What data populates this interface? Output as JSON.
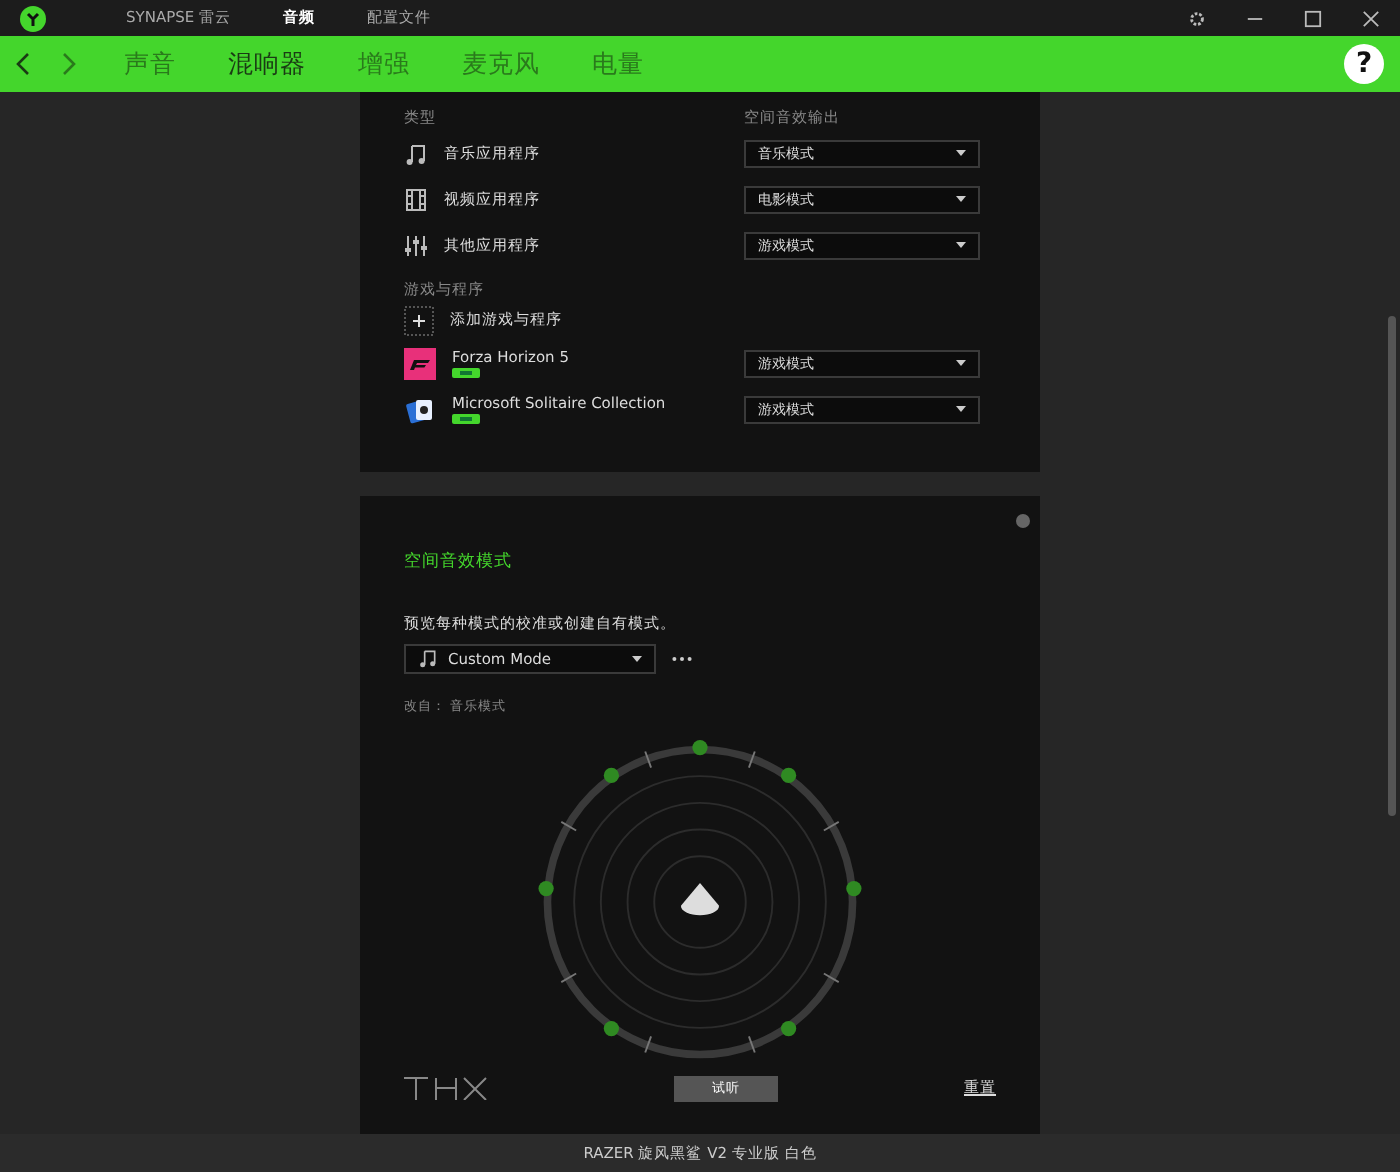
{
  "titlebar": {
    "tabs": [
      {
        "label": "SYNAPSE 雷云",
        "selected": false
      },
      {
        "label": "音频",
        "selected": true
      },
      {
        "label": "配置文件",
        "selected": false
      }
    ]
  },
  "nav": {
    "tabs": [
      {
        "label": "声音",
        "selected": false
      },
      {
        "label": "混响器",
        "selected": true
      },
      {
        "label": "增强",
        "selected": false
      },
      {
        "label": "麦克风",
        "selected": false
      },
      {
        "label": "电量",
        "selected": false
      }
    ],
    "help": "?"
  },
  "types": {
    "heading": "类型",
    "output_heading": "空间音效输出",
    "rows": [
      {
        "kind": "music",
        "label": "音乐应用程序",
        "mode": "音乐模式"
      },
      {
        "kind": "video",
        "label": "视频应用程序",
        "mode": "电影模式"
      },
      {
        "kind": "other",
        "label": "其他应用程序",
        "mode": "游戏模式"
      }
    ]
  },
  "games": {
    "heading": "游戏与程序",
    "add": "添加游戏与程序",
    "items": [
      {
        "kind": "forza",
        "name": "Forza Horizon 5",
        "mode": "游戏模式"
      },
      {
        "kind": "solitaire",
        "name": "Microsoft Solitaire Collection",
        "mode": "游戏模式"
      }
    ]
  },
  "spatial": {
    "title": "空间音效模式",
    "description": "预览每种模式的校准或创建自有模式。",
    "mode": "Custom Mode",
    "modified_from": "改自： 音乐模式",
    "test": "试听",
    "reset": "重置"
  },
  "status_bar": "RAZER 旋风黑鲨 V2 专业版 白色"
}
